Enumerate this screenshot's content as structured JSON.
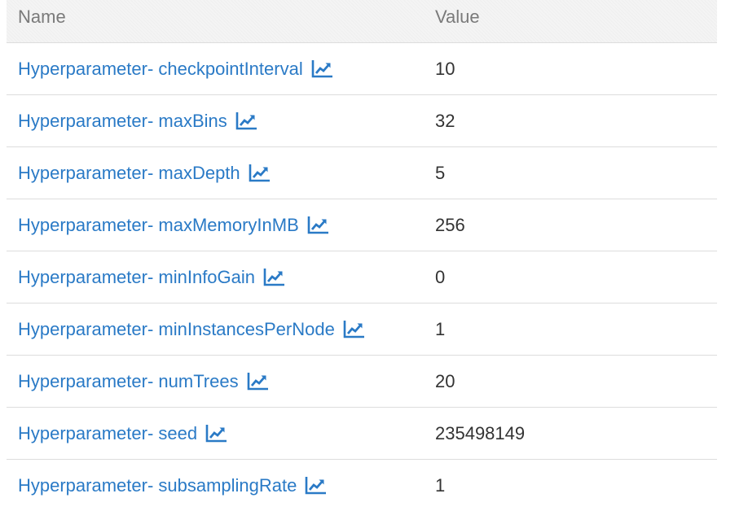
{
  "table": {
    "headers": {
      "name": "Name",
      "value": "Value"
    },
    "rows": [
      {
        "name": "Hyperparameter- checkpointInterval",
        "value": "10",
        "icon": "line-chart-icon"
      },
      {
        "name": "Hyperparameter- maxBins",
        "value": "32",
        "icon": "line-chart-icon"
      },
      {
        "name": "Hyperparameter- maxDepth",
        "value": "5",
        "icon": "line-chart-icon"
      },
      {
        "name": "Hyperparameter- maxMemoryInMB",
        "value": "256",
        "icon": "line-chart-icon"
      },
      {
        "name": "Hyperparameter- minInfoGain",
        "value": "0",
        "icon": "line-chart-icon"
      },
      {
        "name": "Hyperparameter- minInstancesPerNode",
        "value": "1",
        "icon": "line-chart-icon"
      },
      {
        "name": "Hyperparameter- numTrees",
        "value": "20",
        "icon": "line-chart-icon"
      },
      {
        "name": "Hyperparameter- seed",
        "value": "235498149",
        "icon": "line-chart-icon"
      },
      {
        "name": "Hyperparameter- subsamplingRate",
        "value": "1",
        "icon": "line-chart-icon"
      }
    ]
  },
  "colors": {
    "link": "#2a7ac6",
    "header_text": "#7a7a7a",
    "value_text": "#333333",
    "header_bg": "#f4f4f4",
    "divider": "#dddddd"
  }
}
